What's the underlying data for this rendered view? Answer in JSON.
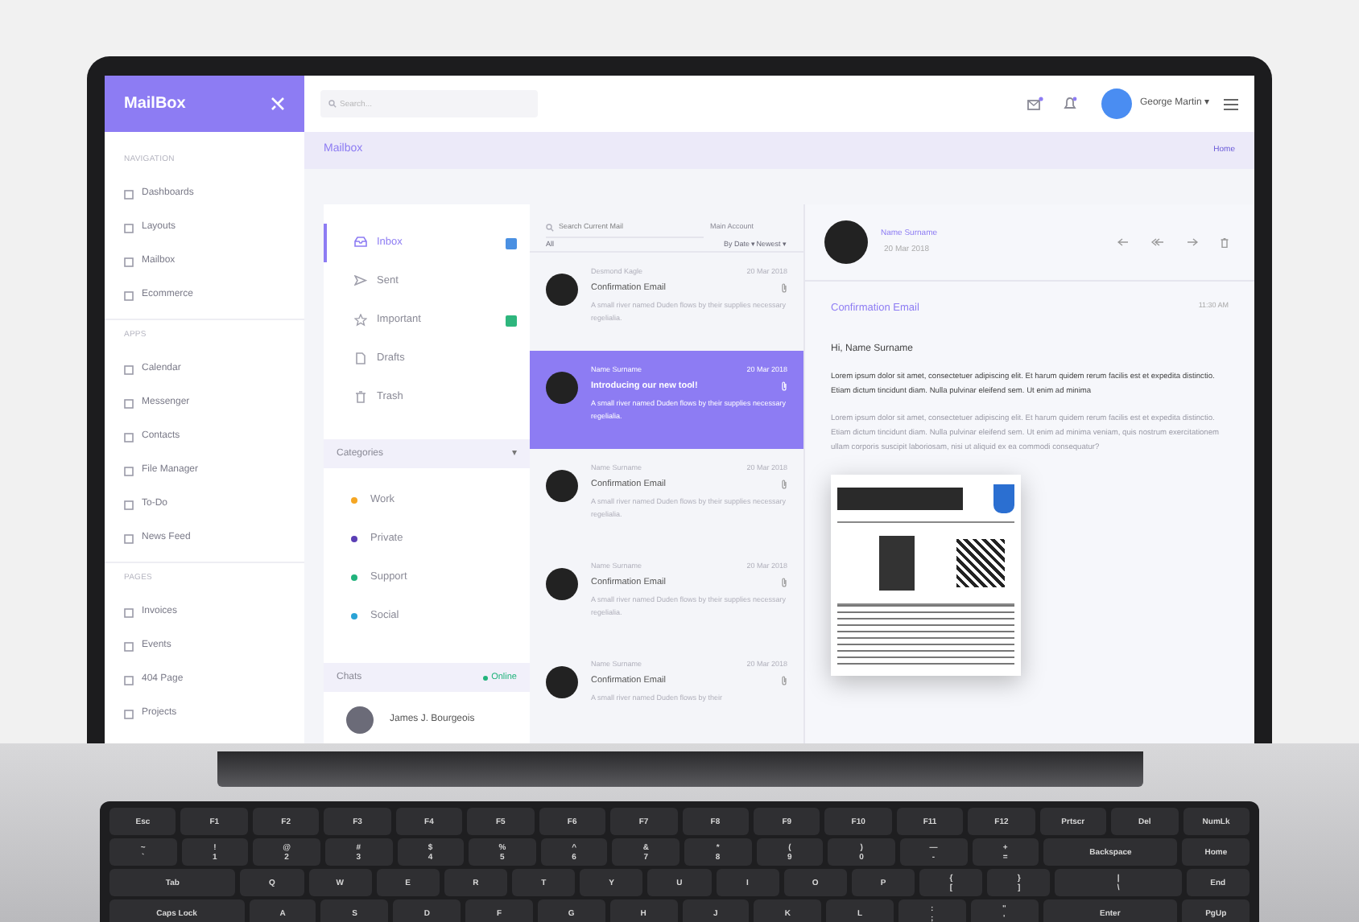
{
  "app": {
    "brand": "MailBox",
    "search": {
      "placeholder": "Search..."
    },
    "user": {
      "name": "George Martin",
      "caret": "▾"
    }
  },
  "breadcrumb": {
    "title": "Mailbox",
    "home": "Home"
  },
  "sidebar": {
    "sections": [
      {
        "label": "NAVIGATION",
        "items": [
          {
            "label": "Dashboards"
          },
          {
            "label": "Layouts"
          },
          {
            "label": "Mailbox"
          },
          {
            "label": "Ecommerce"
          }
        ]
      },
      {
        "label": "APPS",
        "items": [
          {
            "label": "Calendar"
          },
          {
            "label": "Messenger"
          },
          {
            "label": "Contacts"
          },
          {
            "label": "File Manager"
          },
          {
            "label": "To-Do"
          },
          {
            "label": "News Feed"
          }
        ]
      },
      {
        "label": "PAGES",
        "items": [
          {
            "label": "Invoices"
          },
          {
            "label": "Events"
          },
          {
            "label": "404 Page"
          },
          {
            "label": "Projects"
          }
        ]
      }
    ]
  },
  "folders": [
    {
      "label": "Inbox",
      "selected": true,
      "color": "#4a90e2"
    },
    {
      "label": "Sent",
      "selected": false
    },
    {
      "label": "Important",
      "selected": false,
      "color": "#2eb67d"
    },
    {
      "label": "Drafts",
      "selected": false
    },
    {
      "label": "Trash",
      "selected": false
    }
  ],
  "categories": {
    "title": "Categories",
    "caret": "▾",
    "items": [
      {
        "label": "Work",
        "color": "#f5a623"
      },
      {
        "label": "Private",
        "color": "#5b3fb5"
      },
      {
        "label": "Support",
        "color": "#21b37c"
      },
      {
        "label": "Social",
        "color": "#2aa3d6"
      }
    ]
  },
  "chats": {
    "title": "Chats",
    "status": "Online",
    "people": [
      {
        "name": "James J. Bourgeois"
      }
    ]
  },
  "mail_list": {
    "search_placeholder": "Search Current Mail",
    "account": "Main Account",
    "filters": [
      {
        "label": "All"
      },
      {
        "label": "By Date ▾"
      },
      {
        "label": "Newest ▾"
      }
    ],
    "messages": [
      {
        "sender": "Desmond Kagle",
        "date": "20 Mar 2018",
        "subject": "Confirmation Email",
        "snippet": "A small river named Duden flows by their supplies necessary regelialia.",
        "selected": false
      },
      {
        "sender": "Name Surname",
        "date": "20 Mar 2018",
        "subject": "Introducing our new tool!",
        "snippet": "A small river named Duden flows by their supplies necessary regelialia.",
        "selected": true
      },
      {
        "sender": "Name Surname",
        "date": "20 Mar 2018",
        "subject": "Confirmation Email",
        "snippet": "A small river named Duden flows by their supplies necessary regelialia.",
        "selected": false
      },
      {
        "sender": "Name Surname",
        "date": "20 Mar 2018",
        "subject": "Confirmation Email",
        "snippet": "A small river named Duden flows by their supplies necessary regelialia.",
        "selected": false
      },
      {
        "sender": "Name Surname",
        "date": "20 Mar 2018",
        "subject": "Confirmation Email",
        "snippet": "A small river named Duden flows by their",
        "selected": false
      }
    ]
  },
  "message": {
    "sender": "Name Surname",
    "date": "20 Mar 2018",
    "subject": "Confirmation Email",
    "time": "11:30 AM",
    "greeting": "Hi, Name Surname",
    "paragraphs": [
      {
        "text": "Lorem ipsum dolor sit amet, consectetuer adipiscing elit. Et harum quidem rerum facilis est et expedita distinctio. Etiam dictum tincidunt diam. Nulla pulvinar eleifend sem. Ut enim ad minima",
        "muted": false
      },
      {
        "text": "Lorem ipsum dolor sit amet, consectetuer adipiscing elit. Et harum quidem rerum facilis est et expedita distinctio. Etiam dictum tincidunt diam. Nulla pulvinar eleifend sem. Ut enim ad minima veniam, quis nostrum exercitationem ullam corporis suscipit laboriosam, nisi ut aliquid ex ea commodi consequatur?",
        "muted": true
      }
    ]
  },
  "keyboard": {
    "rows": [
      {
        "keys": [
          {
            "legend": "Esc"
          },
          {
            "legend": "F1"
          },
          {
            "legend": "F2"
          },
          {
            "legend": "F3"
          },
          {
            "legend": "F4"
          },
          {
            "legend": "F5"
          },
          {
            "legend": "F6"
          },
          {
            "legend": "F7"
          },
          {
            "legend": "F8"
          },
          {
            "legend": "F9"
          },
          {
            "legend": "F10"
          },
          {
            "legend": "F11"
          },
          {
            "legend": "F12"
          },
          {
            "legend": "Prtscr"
          },
          {
            "legend": "Del"
          },
          {
            "legend": "NumLk"
          }
        ]
      },
      {
        "keys": [
          {
            "top": "~",
            "legend": "`"
          },
          {
            "top": "!",
            "legend": "1"
          },
          {
            "top": "@",
            "legend": "2"
          },
          {
            "top": "#",
            "legend": "3"
          },
          {
            "top": "$",
            "legend": "4"
          },
          {
            "top": "%",
            "legend": "5"
          },
          {
            "top": "^",
            "legend": "6"
          },
          {
            "top": "&",
            "legend": "7"
          },
          {
            "top": "*",
            "legend": "8"
          },
          {
            "top": "(",
            "legend": "9"
          },
          {
            "top": ")",
            "legend": "0"
          },
          {
            "top": "—",
            "legend": "-"
          },
          {
            "top": "+",
            "legend": "="
          },
          {
            "legend": "Backspace",
            "kind": "wide"
          },
          {
            "legend": "Home"
          }
        ]
      },
      {
        "keys": [
          {
            "legend": "Tab",
            "kind": "wide"
          },
          {
            "legend": "Q"
          },
          {
            "legend": "W"
          },
          {
            "legend": "E"
          },
          {
            "legend": "R"
          },
          {
            "legend": "T"
          },
          {
            "legend": "Y"
          },
          {
            "legend": "U"
          },
          {
            "legend": "I"
          },
          {
            "legend": "O"
          },
          {
            "legend": "P"
          },
          {
            "top": "{",
            "legend": "["
          },
          {
            "top": "}",
            "legend": "]"
          },
          {
            "top": "|",
            "legend": "\\",
            "kind": "wide"
          },
          {
            "legend": "End"
          }
        ]
      },
      {
        "keys": [
          {
            "legend": "Caps Lock",
            "kind": "wide"
          },
          {
            "legend": "A"
          },
          {
            "legend": "S"
          },
          {
            "legend": "D"
          },
          {
            "legend": "F"
          },
          {
            "legend": "G"
          },
          {
            "legend": "H"
          },
          {
            "legend": "J"
          },
          {
            "legend": "K"
          },
          {
            "legend": "L"
          },
          {
            "top": ":",
            "legend": ";"
          },
          {
            "top": "\"",
            "legend": "'"
          },
          {
            "legend": "Enter",
            "kind": "wide"
          },
          {
            "legend": "PgUp"
          }
        ]
      }
    ]
  }
}
